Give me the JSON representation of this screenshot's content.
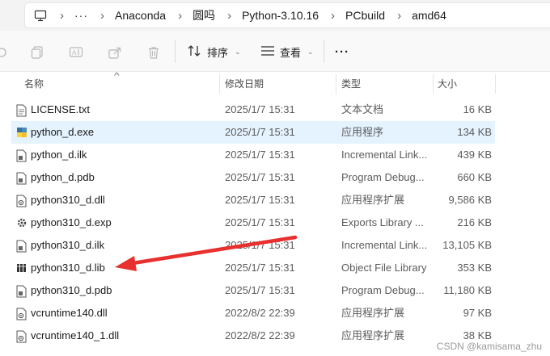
{
  "breadcrumb": {
    "more": "···",
    "items": [
      "Anaconda",
      "圆吗",
      "Python-3.10.16",
      "PCbuild",
      "amd64"
    ]
  },
  "toolbar": {
    "sort_label": "排序",
    "view_label": "查看",
    "more": "···"
  },
  "columns": {
    "name": "名称",
    "date": "修改日期",
    "type": "类型",
    "size": "大小"
  },
  "files": [
    {
      "name": "LICENSE.txt",
      "date": "2025/1/7 15:31",
      "type": "文本文档",
      "size": "16 KB",
      "icon": "text-file-icon"
    },
    {
      "name": "python_d.exe",
      "date": "2025/1/7 15:31",
      "type": "应用程序",
      "size": "134 KB",
      "icon": "python-exe-icon"
    },
    {
      "name": "python_d.ilk",
      "date": "2025/1/7 15:31",
      "type": "Incremental Link...",
      "size": "439 KB",
      "icon": "generic-file-icon"
    },
    {
      "name": "python_d.pdb",
      "date": "2025/1/7 15:31",
      "type": "Program Debug...",
      "size": "660 KB",
      "icon": "generic-file-icon"
    },
    {
      "name": "python310_d.dll",
      "date": "2025/1/7 15:31",
      "type": "应用程序扩展",
      "size": "9,586 KB",
      "icon": "dll-file-icon"
    },
    {
      "name": "python310_d.exp",
      "date": "2025/1/7 15:31",
      "type": "Exports Library ...",
      "size": "216 KB",
      "icon": "exp-file-icon"
    },
    {
      "name": "python310_d.ilk",
      "date": "2025/1/7 15:31",
      "type": "Incremental Link...",
      "size": "13,105 KB",
      "icon": "generic-file-icon"
    },
    {
      "name": "python310_d.lib",
      "date": "2025/1/7 15:31",
      "type": "Object File Library",
      "size": "353 KB",
      "icon": "lib-file-icon"
    },
    {
      "name": "python310_d.pdb",
      "date": "2025/1/7 15:31",
      "type": "Program Debug...",
      "size": "11,180 KB",
      "icon": "generic-file-icon"
    },
    {
      "name": "vcruntime140.dll",
      "date": "2022/8/2 22:39",
      "type": "应用程序扩展",
      "size": "97 KB",
      "icon": "dll-file-icon"
    },
    {
      "name": "vcruntime140_1.dll",
      "date": "2022/8/2 22:39",
      "type": "应用程序扩展",
      "size": "38 KB",
      "icon": "dll-file-icon"
    }
  ],
  "selected_file": "python_d.exe",
  "annotation": {
    "color": "#e8302f",
    "points_to": "python310_d.lib"
  },
  "watermark": "CSDN @kamisama_zhu",
  "colors": {
    "selection": "#e5f3ff",
    "toolbar_bg": "#f9f9f9",
    "topbar_bg": "#f3f3f3"
  }
}
